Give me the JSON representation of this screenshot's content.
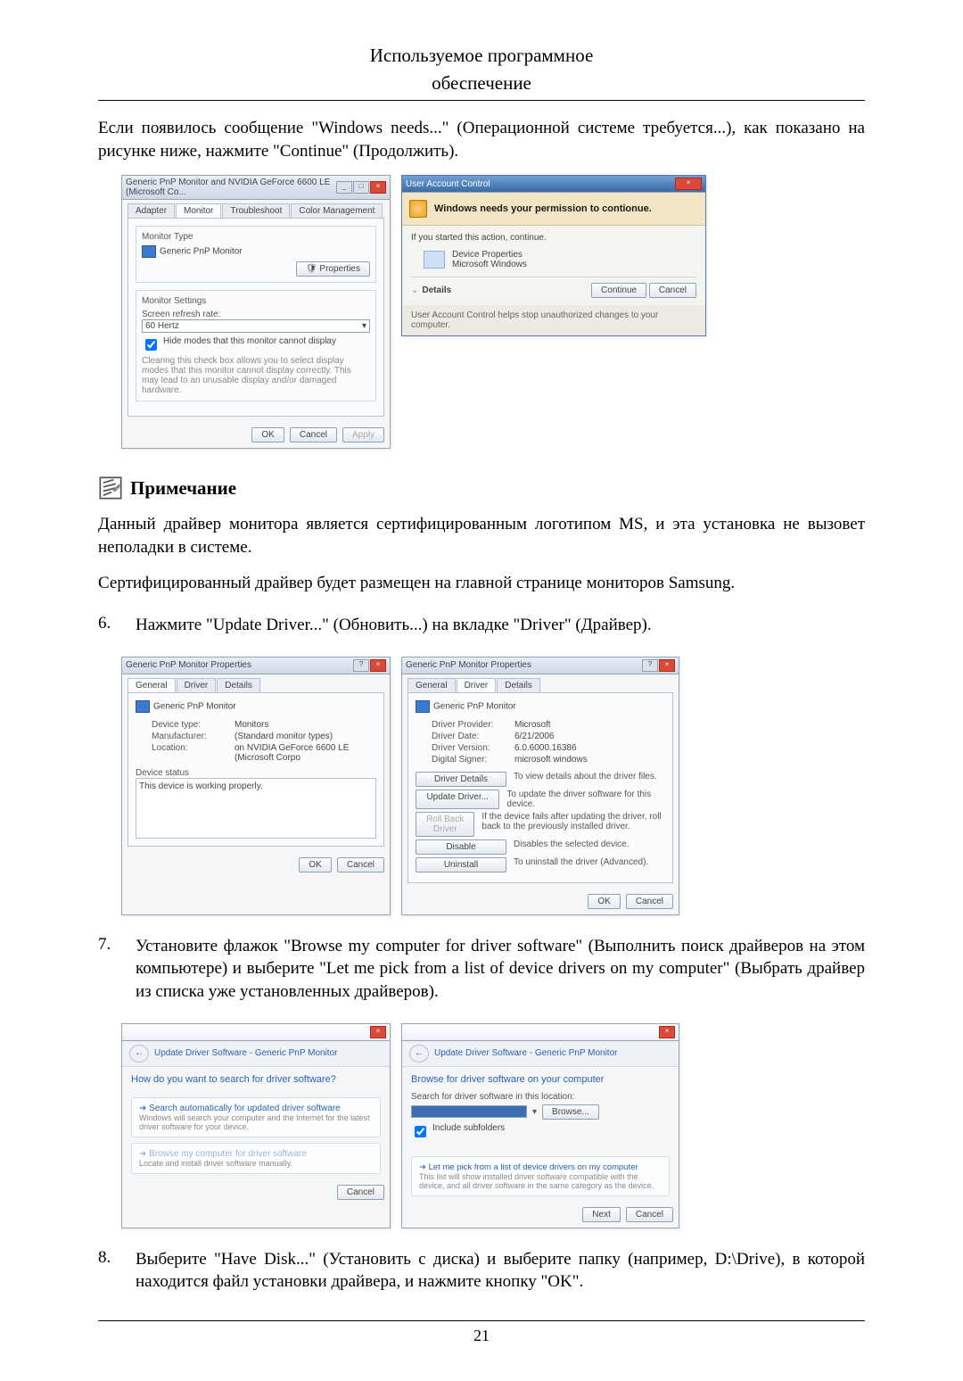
{
  "header": {
    "line1": "Используемое программное",
    "line2": "обеспечение"
  },
  "para1": "Если появилось сообщение \"Windows needs...\" (Операционной системе требуется...), как показано на рисунке ниже, нажмите \"Continue\" (Продолжить).",
  "fig1": {
    "monWin": {
      "title": "Generic PnP Monitor and NVIDIA GeForce 6600 LE (Microsoft Co...",
      "tabs": [
        "Adapter",
        "Monitor",
        "Troubleshoot",
        "Color Management"
      ],
      "monitorType": "Monitor Type",
      "monitorName": "Generic PnP Monitor",
      "propertiesBtn": "Properties",
      "settingsHdr": "Monitor Settings",
      "refreshLbl": "Screen refresh rate:",
      "refreshVal": "60 Hertz",
      "hideChk": "Hide modes that this monitor cannot display",
      "hideNote": "Clearing this check box allows you to select display modes that this monitor cannot display correctly. This may lead to an unusable display and/or damaged hardware.",
      "ok": "OK",
      "cancel": "Cancel",
      "apply": "Apply"
    },
    "uac": {
      "title": "User Account Control",
      "band": "Windows needs your permission to contionue.",
      "ifStarted": "If you started this action, continue.",
      "app1": "Device Properties",
      "app2": "Microsoft Windows",
      "details": "Details",
      "continue": "Continue",
      "cancel": "Cancel",
      "foot": "User Account Control helps stop unauthorized changes to your computer."
    }
  },
  "note": {
    "title": "Примечание"
  },
  "noteP1": "Данный драйвер монитора является сертифицированным логотипом MS, и эта установка не вызовет неполадки в системе.",
  "noteP2": "Сертифицированный драйвер будет размещен на главной странице мониторов Samsung.",
  "step6": {
    "num": "6.",
    "text": "Нажмите \"Update Driver...\" (Обновить...) на вкладке \"Driver\" (Драйвер)."
  },
  "fig2": {
    "general": {
      "title": "Generic PnP Monitor Properties",
      "tabs": [
        "General",
        "Driver",
        "Details"
      ],
      "name": "Generic PnP Monitor",
      "rows": {
        "devtypeK": "Device type:",
        "devtypeV": "Monitors",
        "mfgK": "Manufacturer:",
        "mfgV": "(Standard monitor types)",
        "locK": "Location:",
        "locV": "on NVIDIA GeForce 6600 LE (Microsoft Corpo"
      },
      "statusHdr": "Device status",
      "statusTxt": "This device is working properly.",
      "ok": "OK",
      "cancel": "Cancel"
    },
    "driver": {
      "title": "Generic PnP Monitor Properties",
      "tabs": [
        "General",
        "Driver",
        "Details"
      ],
      "name": "Generic PnP Monitor",
      "rows": {
        "provK": "Driver Provider:",
        "provV": "Microsoft",
        "dateK": "Driver Date:",
        "dateV": "6/21/2006",
        "verK": "Driver Version:",
        "verV": "6.0.6000.16386",
        "sigK": "Digital Signer:",
        "sigV": "microsoft windows"
      },
      "btns": {
        "details": "Driver Details",
        "detailsD": "To view details about the driver files.",
        "update": "Update Driver...",
        "updateD": "To update the driver software for this device.",
        "roll": "Roll Back Driver",
        "rollD": "If the device fails after updating the driver, roll back to the previously installed driver.",
        "disable": "Disable",
        "disableD": "Disables the selected device.",
        "uninstall": "Uninstall",
        "uninstallD": "To uninstall the driver (Advanced)."
      },
      "ok": "OK",
      "cancel": "Cancel"
    }
  },
  "step7": {
    "num": "7.",
    "text": "Установите флажок \"Browse my computer for driver software\" (Выполнить поиск драйверов на этом компьютере) и выберите \"Let me pick from a list of device drivers on my computer\" (Выбрать драйвер из списка уже установленных драйверов)."
  },
  "fig3": {
    "search": {
      "barTitle": "Update Driver Software - Generic PnP Monitor",
      "hd": "How do you want to search for driver software?",
      "opt1T": "Search automatically for updated driver software",
      "opt1S": "Windows will search your computer and the Internet for the latest driver software for your device.",
      "opt2T": "Browse my computer for driver software",
      "opt2S": "Locate and install driver software manually.",
      "cancel": "Cancel"
    },
    "browse": {
      "barTitle": "Update Driver Software - Generic PnP Monitor",
      "hd": "Browse for driver software on your computer",
      "searchLbl": "Search for driver software in this location:",
      "browseBtn": "Browse...",
      "include": "Include subfolders",
      "pickT": "Let me pick from a list of device drivers on my computer",
      "pickS": "This list will show installed driver software compatible with the device, and all driver software in the same category as the device.",
      "next": "Next",
      "cancel": "Cancel"
    }
  },
  "step8": {
    "num": "8.",
    "text": "Выберите \"Have Disk...\" (Установить с диска) и выберите папку (например, D:\\Drive), в которой находится файл установки драйвера, и нажмите кнопку \"OK\"."
  },
  "pageNumber": "21"
}
